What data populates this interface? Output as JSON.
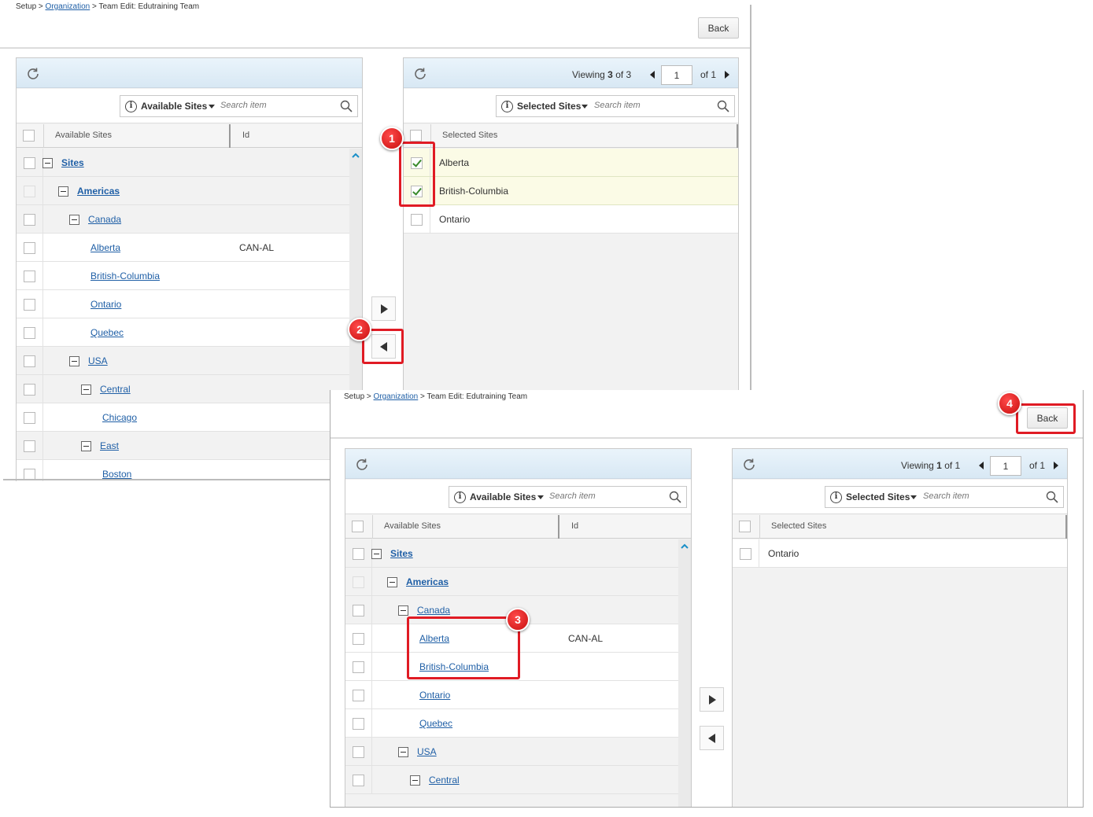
{
  "breadcrumb": {
    "setup": "Setup >",
    "organization": "Organization",
    "rest": "> Team Edit: Edutraining Team"
  },
  "back_label": "Back",
  "search_placeholder": "Search item",
  "available": {
    "dropdown_label": "Available Sites",
    "col_available": "Available Sites",
    "col_id": "Id"
  },
  "selected": {
    "dropdown_label": "Selected Sites",
    "col_selected": "Selected Sites"
  },
  "screen1": {
    "pager": {
      "viewing_prefix": "Viewing",
      "viewing_count": "3",
      "viewing_of": "of 3",
      "page": "1",
      "of_pages": "of 1"
    },
    "tree": [
      {
        "label": "Sites",
        "id": "",
        "checkbox": "normal"
      },
      {
        "label": "Americas",
        "id": "",
        "checkbox": "disabled"
      },
      {
        "label": "Canada",
        "id": "",
        "checkbox": "normal"
      },
      {
        "label": "Alberta",
        "id": "CAN-AL",
        "checkbox": "normal"
      },
      {
        "label": "British-Columbia",
        "id": "",
        "checkbox": "normal"
      },
      {
        "label": "Ontario",
        "id": "",
        "checkbox": "normal"
      },
      {
        "label": "Quebec",
        "id": "",
        "checkbox": "normal"
      },
      {
        "label": "USA",
        "id": "",
        "checkbox": "normal"
      },
      {
        "label": "Central",
        "id": "",
        "checkbox": "normal"
      },
      {
        "label": "Chicago",
        "id": "",
        "checkbox": "normal"
      },
      {
        "label": "East",
        "id": "",
        "checkbox": "normal"
      },
      {
        "label": "Boston",
        "id": "",
        "checkbox": "normal"
      }
    ],
    "selected_rows": [
      {
        "label": "Alberta",
        "checked": true
      },
      {
        "label": "British-Columbia",
        "checked": true
      },
      {
        "label": "Ontario",
        "checked": false
      }
    ]
  },
  "screen2": {
    "pager": {
      "viewing_prefix": "Viewing",
      "viewing_count": "1",
      "viewing_of": "of 1",
      "page": "1",
      "of_pages": "of 1"
    },
    "tree": [
      {
        "label": "Sites",
        "id": "",
        "checkbox": "normal"
      },
      {
        "label": "Americas",
        "id": "",
        "checkbox": "disabled"
      },
      {
        "label": "Canada",
        "id": "",
        "checkbox": "normal"
      },
      {
        "label": "Alberta",
        "id": "CAN-AL",
        "checkbox": "normal"
      },
      {
        "label": "British-Columbia",
        "id": "",
        "checkbox": "normal"
      },
      {
        "label": "Ontario",
        "id": "",
        "checkbox": "normal"
      },
      {
        "label": "Quebec",
        "id": "",
        "checkbox": "normal"
      },
      {
        "label": "USA",
        "id": "",
        "checkbox": "normal"
      },
      {
        "label": "Central",
        "id": "",
        "checkbox": "normal"
      }
    ],
    "selected_rows": [
      {
        "label": "Ontario",
        "checked": false
      }
    ]
  },
  "markers": [
    "1",
    "2",
    "3",
    "4"
  ],
  "colors": {
    "link": "#1f5fa6",
    "marker": "#e01b24",
    "highlight_row": "#fbfbe6"
  }
}
